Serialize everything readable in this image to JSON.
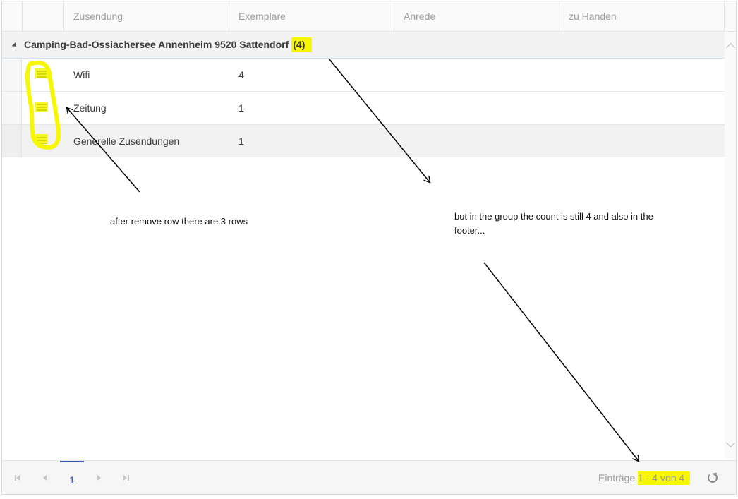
{
  "columns": [
    "",
    "",
    "Zusendung",
    "Exemplare",
    "Anrede",
    "zu Handen"
  ],
  "group": {
    "label": "Camping-Bad-Ossiachersee Annenheim 9520 Sattendorf",
    "count": "(4)"
  },
  "rows": [
    {
      "zusendung": "Wifi",
      "exemplare": "4",
      "anrede": "",
      "zu_handen": ""
    },
    {
      "zusendung": "Zeitung",
      "exemplare": "1",
      "anrede": "",
      "zu_handen": ""
    },
    {
      "zusendung": "Generelle Zusendungen",
      "exemplare": "1",
      "anrede": "",
      "zu_handen": ""
    }
  ],
  "pager": {
    "page": "1",
    "entries_prefix": "Einträge",
    "entries_range": "1 - 4 von 4"
  },
  "annotations": {
    "note1": "after remove row there are 3 rows",
    "note2": "but in the group the count is still 4 and also in the footer..."
  },
  "colors": {
    "highlight": "#f7f700",
    "pager_accent": "#3a56b0"
  },
  "icons": [
    "menu-icon",
    "collapse-triangle-icon",
    "first-page-icon",
    "prev-page-icon",
    "next-page-icon",
    "last-page-icon",
    "refresh-icon",
    "scroll-up-icon",
    "scroll-down-icon"
  ]
}
